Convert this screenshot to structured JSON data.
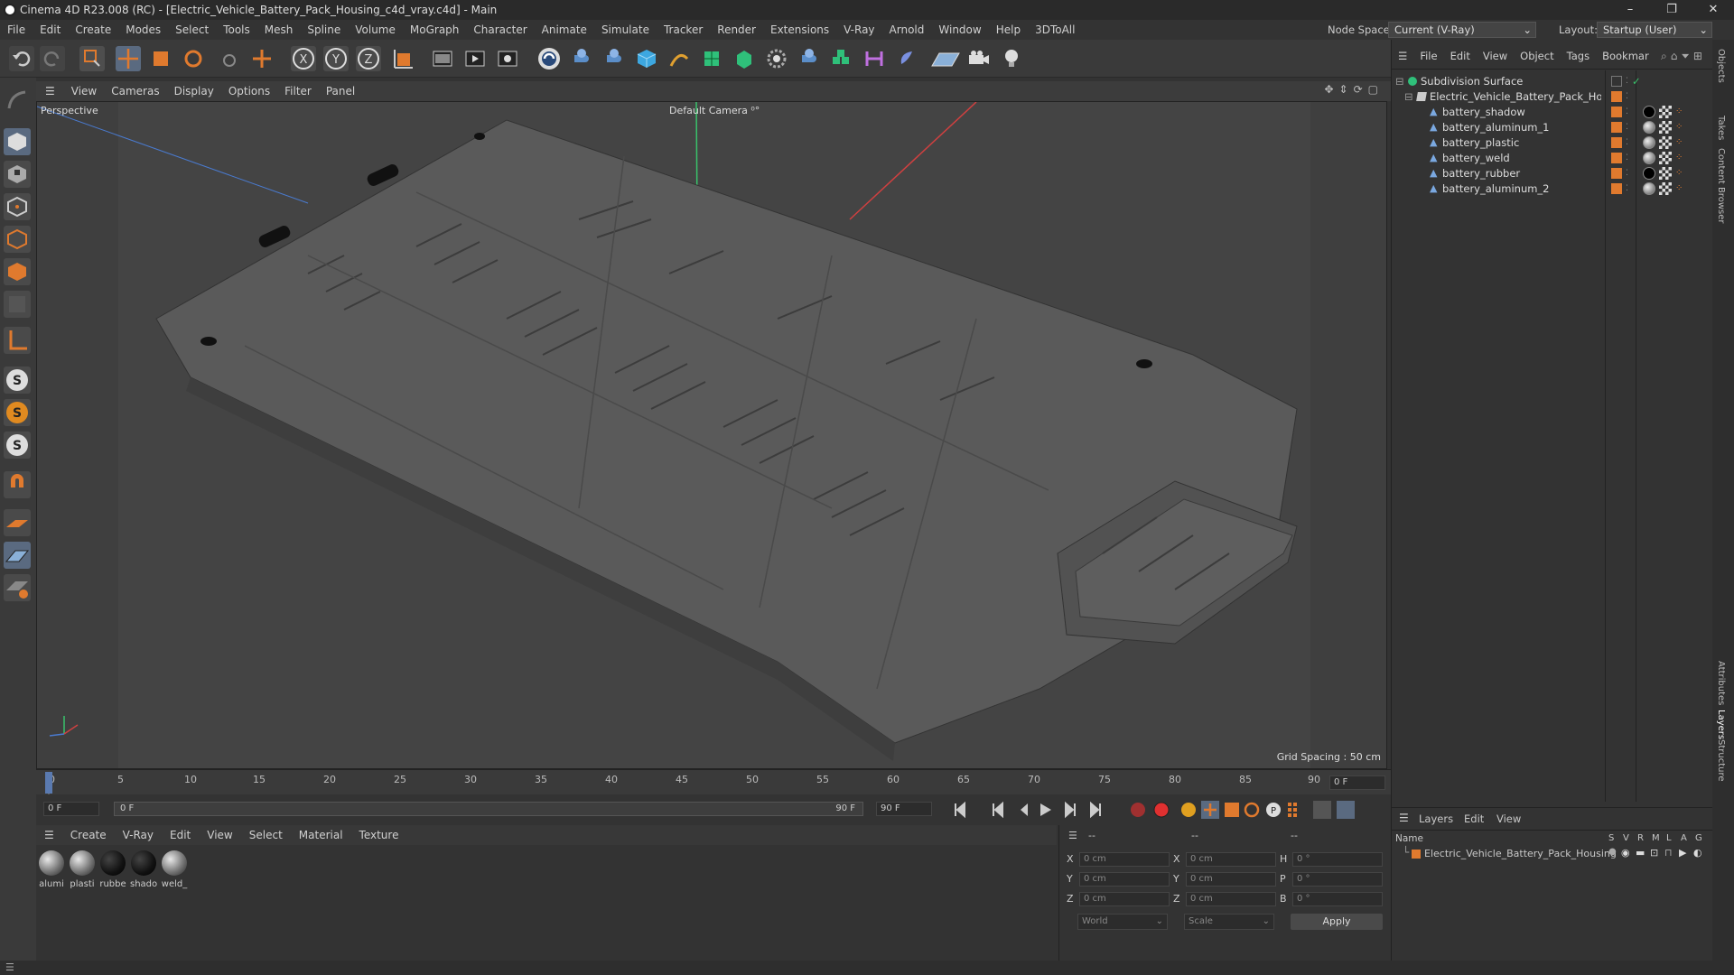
{
  "window": {
    "title": "Cinema 4D R23.008 (RC) - [Electric_Vehicle_Battery_Pack_Housing_c4d_vray.c4d] - Main",
    "controls": [
      "–",
      "❐",
      "✕"
    ]
  },
  "menubar": {
    "items": [
      "File",
      "Edit",
      "Create",
      "Modes",
      "Select",
      "Tools",
      "Mesh",
      "Spline",
      "Volume",
      "MoGraph",
      "Character",
      "Animate",
      "Simulate",
      "Tracker",
      "Render",
      "Extensions",
      "V-Ray",
      "Arnold",
      "Window",
      "Help",
      "3DToAll"
    ],
    "node_space_label": "Node Space:",
    "node_space_value": "Current (V-Ray)",
    "layout_label": "Layout:",
    "layout_value": "Startup (User)"
  },
  "viewport": {
    "menu": [
      "View",
      "Cameras",
      "Display",
      "Options",
      "Filter",
      "Panel"
    ],
    "view_name": "Perspective",
    "camera": "Default Camera",
    "grid_spacing": "Grid Spacing : 50 cm"
  },
  "timeline": {
    "ticks": [
      "0",
      "5",
      "10",
      "15",
      "20",
      "25",
      "30",
      "35",
      "40",
      "45",
      "50",
      "55",
      "60",
      "65",
      "70",
      "75",
      "80",
      "85",
      "90"
    ],
    "end_frame_field": "0 F",
    "current_frame": "0 F",
    "range_start": "0 F",
    "range_end": "90 F",
    "max_frame": "90 F"
  },
  "materials": {
    "menu": [
      "Create",
      "V-Ray",
      "Edit",
      "View",
      "Select",
      "Material",
      "Texture"
    ],
    "items": [
      {
        "label": "alumi",
        "dark": false
      },
      {
        "label": "plasti",
        "dark": false
      },
      {
        "label": "rubbe",
        "dark": true
      },
      {
        "label": "shado",
        "dark": true
      },
      {
        "label": "weld_",
        "dark": false
      }
    ]
  },
  "coordinates": {
    "header": [
      "--",
      "--",
      "--"
    ],
    "rows": [
      {
        "axis": "X",
        "pos": "0 cm",
        "axis2": "X",
        "size": "0 cm",
        "rot_axis": "H",
        "rot": "0 °"
      },
      {
        "axis": "Y",
        "pos": "0 cm",
        "axis2": "Y",
        "size": "0 cm",
        "rot_axis": "P",
        "rot": "0 °"
      },
      {
        "axis": "Z",
        "pos": "0 cm",
        "axis2": "Z",
        "size": "0 cm",
        "rot_axis": "B",
        "rot": "0 °"
      }
    ],
    "world": "World",
    "scale": "Scale",
    "apply": "Apply"
  },
  "objects": {
    "menu": [
      "File",
      "Edit",
      "View",
      "Object",
      "Tags",
      "Bookmar"
    ],
    "tree": [
      {
        "name": "Subdivision Surface",
        "level": 0
      },
      {
        "name": "Electric_Vehicle_Battery_Pack_Housing",
        "level": 1
      },
      {
        "name": "battery_shadow",
        "level": 2
      },
      {
        "name": "battery_aluminum_1",
        "level": 2
      },
      {
        "name": "battery_plastic",
        "level": 2
      },
      {
        "name": "battery_weld",
        "level": 2
      },
      {
        "name": "battery_rubber",
        "level": 2
      },
      {
        "name": "battery_aluminum_2",
        "level": 2
      }
    ]
  },
  "layers": {
    "menu": [
      "Layers",
      "Edit",
      "View"
    ],
    "col_name": "Name",
    "cols": [
      "S",
      "V",
      "R",
      "M",
      "L",
      "A",
      "G"
    ],
    "row": "Electric_Vehicle_Battery_Pack_Housing"
  },
  "side_tabs": [
    "Objects",
    "Takes",
    "Content Browser",
    "Attributes",
    "Layers",
    "Structure"
  ],
  "colors": {
    "accent_orange": "#e07a2e",
    "axis_green": "#39c26b",
    "axis_red": "#d04040",
    "axis_blue": "#4a7bd0"
  }
}
